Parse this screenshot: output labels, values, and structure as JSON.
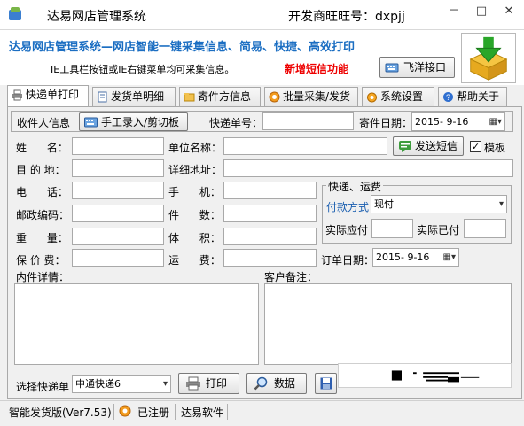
{
  "window": {
    "title": "达易网店管理系统",
    "developer": "开发商旺旺号：dxpjj",
    "controls": [
      "－",
      "□",
      "✕"
    ]
  },
  "banner": {
    "slogan": "达易网店管理系统—网店智能一键采集信息、简易、快捷、高效打印",
    "tip": "IE工具栏按钮或IE右键菜单均可采集信息。",
    "new_feature": "新增短信功能",
    "feixiang_button": "飞洋接口"
  },
  "tabs": [
    {
      "label": "快递单打印",
      "icon": "printer-icon"
    },
    {
      "label": "发货单明细",
      "icon": "document-icon"
    },
    {
      "label": "寄件方信息",
      "icon": "folder-icon"
    },
    {
      "label": "批量采集/发货",
      "icon": "batch-icon"
    },
    {
      "label": "系统设置",
      "icon": "settings-icon"
    },
    {
      "label": "帮助关于",
      "icon": "help-icon"
    }
  ],
  "form": {
    "recipient_info": "收件人信息",
    "manual_entry_button": "手工录入/剪切板",
    "tracking_no_label": "快递单号：",
    "tracking_no_value": "",
    "send_date_label": "寄件日期：",
    "send_date_value": "2015- 9-16",
    "name_label": "姓      名：",
    "company_label": "单位名称：",
    "send_sms_button": "发送短信",
    "template_label": "模板",
    "template_checked": true,
    "destination_label": "目 的 地：",
    "address_label": "详细地址：",
    "phone_label": "电      话：",
    "mobile_label": "手      机：",
    "postcode_label": "邮政编码：",
    "pieces_label": "件      数：",
    "weight_label": "重      量：",
    "volume_label": "体      积：",
    "insured_label": "保 价 费：",
    "freight_label": "运      费：",
    "order_date_label": "订单日期：",
    "order_date_value": "2015- 9-16",
    "shipping_group": "快递、运费",
    "payment_label": "付款方式",
    "payment_value": "现付",
    "payable_label": "实际应付",
    "paid_label": "实际已付",
    "content_label": "内件详情：",
    "remark_label": "客户备注：",
    "courier_label": "选择快递单",
    "courier_value": "中通快递6",
    "print_button": "打印",
    "data_button": "数据"
  },
  "statusbar": {
    "edition": "智能发货版(Ver7.53)",
    "registration": "已注册",
    "company": "达易软件"
  },
  "colors": {
    "slogan": "#1b6ec2",
    "new_feature": "#e00000"
  }
}
